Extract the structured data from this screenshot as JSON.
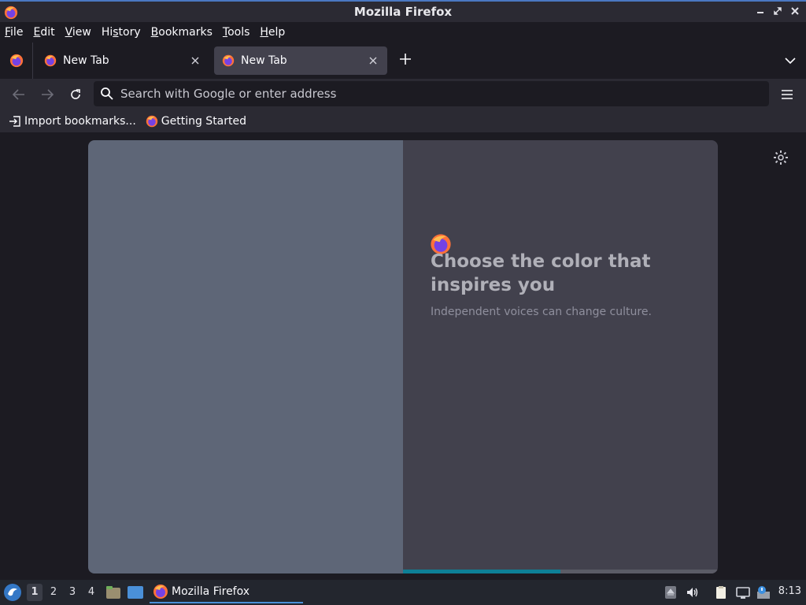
{
  "window": {
    "title": "Mozilla Firefox"
  },
  "menu": [
    {
      "label": "File",
      "mnemonic": "F",
      "rest": "ile"
    },
    {
      "label": "Edit",
      "mnemonic": "E",
      "rest": "dit"
    },
    {
      "label": "View",
      "mnemonic": "V",
      "rest": "iew"
    },
    {
      "label": "History",
      "mnemonic": "s",
      "pre": "Hi",
      "rest": "tory"
    },
    {
      "label": "Bookmarks",
      "mnemonic": "B",
      "rest": "ookmarks"
    },
    {
      "label": "Tools",
      "mnemonic": "T",
      "rest": "ools"
    },
    {
      "label": "Help",
      "mnemonic": "H",
      "rest": "elp"
    }
  ],
  "tabs": [
    {
      "label": "New Tab",
      "active": false
    },
    {
      "label": "New Tab",
      "active": true
    }
  ],
  "urlbar": {
    "placeholder": "Search with Google or enter address",
    "value": ""
  },
  "bookmarks": [
    {
      "label": "Import bookmarks...",
      "icon": "import-icon"
    },
    {
      "label": "Getting Started",
      "icon": "firefox-icon"
    }
  ],
  "onboarding": {
    "heading": "Choose the color that inspires you",
    "subheading": "Independent voices can change culture.",
    "progress": 0.5
  },
  "taskbar": {
    "workspaces": [
      "1",
      "2",
      "3",
      "4"
    ],
    "active_workspace": "1",
    "task_label": "Mozilla Firefox",
    "clock": "8:13"
  },
  "colors": {
    "accent": "#4a90d9",
    "progress": "#0e7f96",
    "left_pane": "#5e6677",
    "right_pane": "#42414d"
  }
}
